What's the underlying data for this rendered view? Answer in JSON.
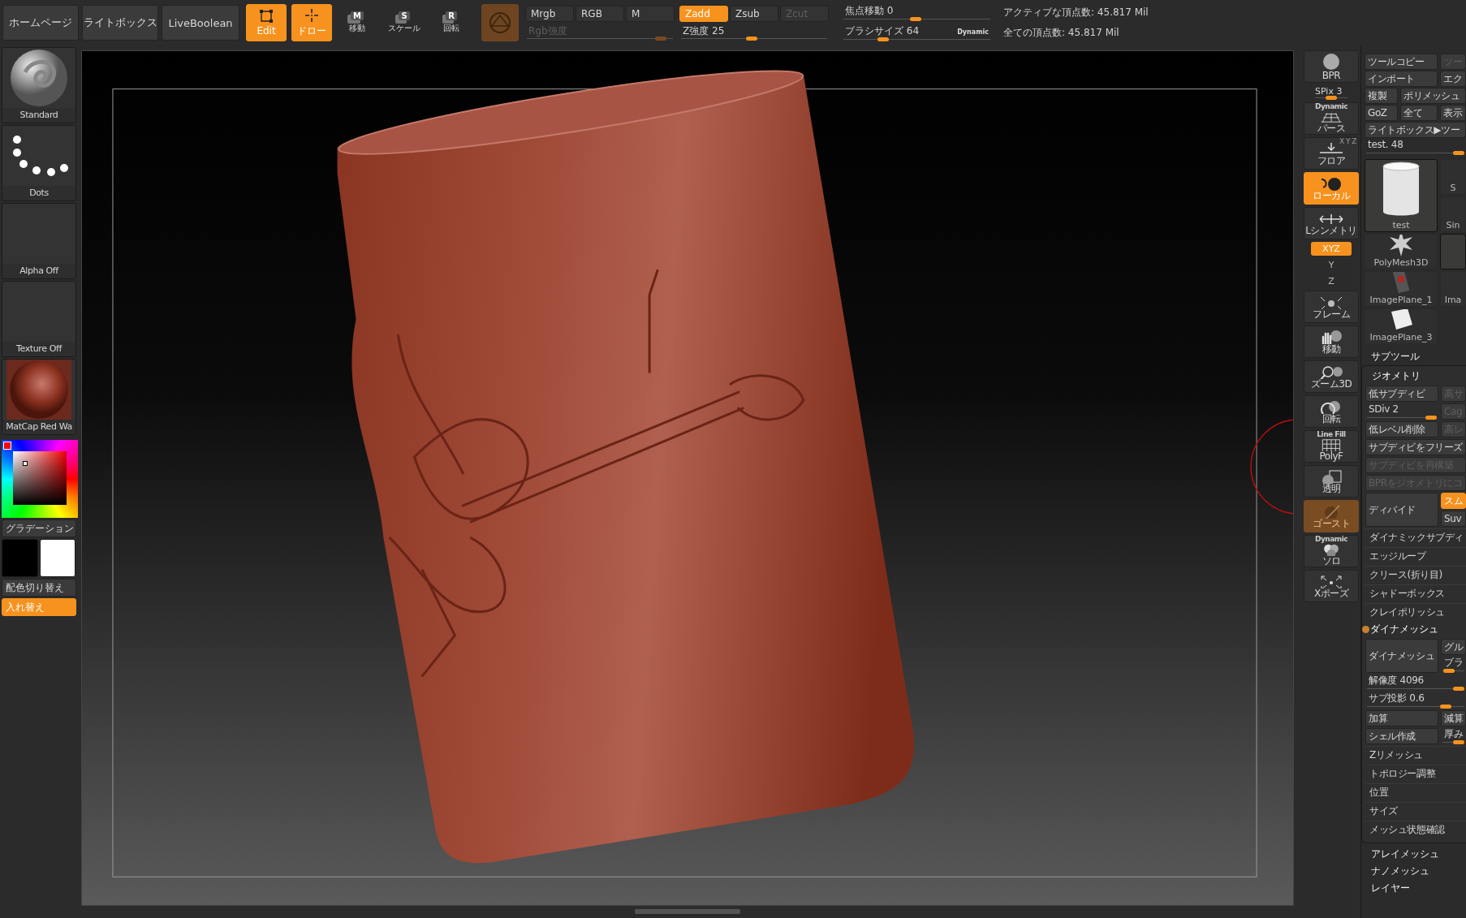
{
  "top_bar": {
    "nav_buttons": [
      "ホームページ",
      "ライトボックス",
      "LiveBoolean"
    ],
    "mode_buttons": [
      {
        "kind": "edit",
        "label": "Edit",
        "selected": true
      },
      {
        "kind": "draw",
        "label": "ドロー",
        "selected": true
      }
    ],
    "transform_buttons": [
      {
        "key": "M",
        "label": "移動"
      },
      {
        "key": "S",
        "label": "スケール"
      },
      {
        "key": "R",
        "label": "回転"
      }
    ],
    "channel_groups": [
      {
        "buttons": [
          {
            "label": "Mrgb",
            "selected": false,
            "disabled": false
          },
          {
            "label": "RGB",
            "selected": false,
            "disabled": false
          },
          {
            "label": "M",
            "selected": false,
            "disabled": false
          }
        ],
        "slider": {
          "label": "Rgb強度",
          "disabled": true,
          "level": 0.95
        }
      },
      {
        "buttons": [
          {
            "label": "Zadd",
            "selected": true,
            "disabled": false
          },
          {
            "label": "Zsub",
            "selected": false,
            "disabled": false
          },
          {
            "label": "Zcut",
            "selected": false,
            "disabled": true
          }
        ],
        "slider": {
          "label": "Z強度 25",
          "disabled": false,
          "level": 0.48
        }
      }
    ],
    "brush_sliders": [
      {
        "label": "焦点移動 0",
        "level": 0.49
      },
      {
        "label": "ブラシサイズ 64",
        "badge": "Dynamic",
        "level": 0.25
      }
    ],
    "stats": [
      "アクティブな頂点数: 45.817 Mil",
      "全ての頂点数: 45.817 Mil"
    ]
  },
  "left_shelf": {
    "tiles": [
      {
        "kind": "brush",
        "label": "Standard"
      },
      {
        "kind": "stroke",
        "label": "Dots"
      },
      {
        "kind": "alpha",
        "label": "Alpha Off"
      },
      {
        "kind": "texture",
        "label": "Texture Off"
      },
      {
        "kind": "material",
        "label": "MatCap Red Wa"
      }
    ],
    "gradient_button": "グラデーション",
    "swatches": [
      {
        "color": "#000000"
      },
      {
        "color": "#ffffff"
      }
    ],
    "buttons": [
      {
        "label": "配色切り替え",
        "selected": false
      },
      {
        "label": "入れ替え",
        "selected": true
      }
    ]
  },
  "view_toolbar": [
    {
      "kind": "bpr",
      "label": "BPR"
    },
    {
      "kind": "slider",
      "label": "SPix 3",
      "level": 0.5
    },
    {
      "kind": "perspective",
      "caption": "Dynamic",
      "label": "パース",
      "selected": false,
      "disabled": false
    },
    {
      "kind": "floor",
      "caption": "X Y Z",
      "label": "フロア",
      "selected": false,
      "disabled": false
    },
    {
      "kind": "local",
      "label": "ローカル",
      "selected": true,
      "disabled": false
    },
    {
      "kind": "symmetry",
      "label": "Lシンメトリ",
      "selected": false,
      "disabled": false
    },
    {
      "kind": "axis",
      "label": "XYZ",
      "selected": true,
      "disabled": false
    },
    {
      "kind": "axis",
      "label": "Y",
      "selected": false,
      "disabled": false
    },
    {
      "kind": "axis",
      "label": "Z",
      "selected": false,
      "disabled": false
    },
    {
      "kind": "frame",
      "label": "フレーム",
      "selected": false,
      "disabled": false
    },
    {
      "kind": "move",
      "label": "移動",
      "selected": false,
      "disabled": false
    },
    {
      "kind": "zoom",
      "label": "ズーム3D",
      "selected": false,
      "disabled": false
    },
    {
      "kind": "rotate",
      "label": "回転",
      "selected": false,
      "disabled": false
    },
    {
      "kind": "polyf",
      "caption": "Line Fill",
      "label": "PolyF",
      "selected": false,
      "disabled": false
    },
    {
      "kind": "transparent",
      "label": "透明",
      "selected": false,
      "disabled": false
    },
    {
      "kind": "ghost",
      "label": "ゴースト",
      "selected": false,
      "disabled": true
    },
    {
      "kind": "solo",
      "caption": "Dynamic",
      "label": "ソロ",
      "selected": false,
      "disabled": false
    },
    {
      "kind": "xpose",
      "label": "Xポーズ",
      "selected": false,
      "disabled": false
    }
  ],
  "tool_panel": {
    "rows": [
      {
        "kind": "pair",
        "items": [
          {
            "kind": "button",
            "label": "ツールコピー",
            "disabled": false
          },
          {
            "kind": "button",
            "label": "ツー",
            "disabled": true
          }
        ]
      },
      {
        "kind": "pair",
        "items": [
          {
            "kind": "button",
            "label": "インポート",
            "disabled": false
          },
          {
            "kind": "button",
            "label": "エク",
            "disabled": false
          }
        ]
      },
      {
        "kind": "lead",
        "items": [
          {
            "kind": "button",
            "label": "複製",
            "disabled": false
          },
          {
            "kind": "button",
            "label": "ポリメッシュ",
            "disabled": false
          }
        ]
      },
      {
        "kind": "trio",
        "items": [
          {
            "kind": "button",
            "label": "GoZ",
            "disabled": false
          },
          {
            "kind": "button",
            "label": "全て",
            "disabled": false
          },
          {
            "kind": "button",
            "label": "表示",
            "disabled": false
          }
        ]
      },
      {
        "kind": "full",
        "items": [
          {
            "kind": "button",
            "label": "ライトボックス▶ツー",
            "disabled": false
          }
        ]
      },
      {
        "kind": "full",
        "items": [
          {
            "kind": "slider",
            "label": "test. 48",
            "level": 1
          }
        ]
      }
    ],
    "thumbnails": [
      {
        "kind": "cylinder",
        "label": "test",
        "selected": true
      },
      {
        "kind": "star",
        "label": "PolyMesh3D",
        "selected": false
      },
      {
        "kind": "card",
        "label": "ImagePlane_1",
        "selected": false
      },
      {
        "kind": "cube",
        "label": "ImagePlane_3",
        "selected": false
      },
      {
        "kind": "blank",
        "label": "S",
        "selected": false
      },
      {
        "kind": "blank",
        "label": "Sin",
        "selected": false
      },
      {
        "kind": "blank",
        "selected": true
      },
      {
        "kind": "blank",
        "label": "Ima",
        "selected": false
      }
    ]
  },
  "subtool_header": "サブツール",
  "geometry": {
    "title": "ジオメトリ",
    "rows": [
      {
        "kind": "pair",
        "items": [
          {
            "kind": "button",
            "label": "低サブディビ",
            "disabled": false
          },
          {
            "kind": "button",
            "label": "高サ",
            "disabled": true
          }
        ]
      },
      {
        "kind": "pair",
        "items": [
          {
            "kind": "slider",
            "label": "SDiv 2",
            "level": 1
          },
          {
            "kind": "button",
            "label": "Cag",
            "disabled": true
          }
        ]
      },
      {
        "kind": "pair",
        "items": [
          {
            "kind": "button",
            "label": "低レベル削除",
            "disabled": false
          },
          {
            "kind": "button",
            "label": "高レ",
            "disabled": true
          }
        ]
      },
      {
        "kind": "full",
        "items": [
          {
            "kind": "button",
            "label": "サブディビをフリーズ",
            "disabled": false
          }
        ]
      },
      {
        "kind": "full",
        "items": [
          {
            "kind": "button",
            "label": "サブディビを再構築",
            "disabled": true
          }
        ]
      },
      {
        "kind": "full",
        "items": [
          {
            "kind": "button",
            "label": "BPRをジオメトリにコ",
            "disabled": true
          }
        ]
      },
      {
        "kind": "block",
        "items": [
          {
            "kind": "button",
            "label": "ディバイド",
            "disabled": false
          },
          {
            "kind": "button",
            "label": "スム",
            "disabled": false,
            "selected": true
          },
          {
            "kind": "button",
            "label": "Suv",
            "disabled": false
          }
        ]
      },
      {
        "kind": "menu",
        "label": "ダイナミックサブディ"
      },
      {
        "kind": "menu",
        "label": "エッジループ"
      },
      {
        "kind": "menu",
        "label": "クリース(折り目)"
      },
      {
        "kind": "menu",
        "label": "シャドーボックス"
      },
      {
        "kind": "menu",
        "label": "クレイポリッシュ"
      },
      {
        "kind": "toggle",
        "label": "ダイナメッシュ",
        "on": true
      },
      {
        "kind": "block",
        "items": [
          {
            "kind": "button",
            "label": "ダイナメッシュ",
            "disabled": false
          },
          {
            "kind": "button",
            "label": "グル",
            "disabled": false
          },
          {
            "kind": "slider",
            "label": "ブラ",
            "level": 0.1
          }
        ]
      },
      {
        "kind": "full",
        "items": [
          {
            "kind": "slider",
            "label": "解像度 4096",
            "level": 1
          }
        ]
      },
      {
        "kind": "full",
        "items": [
          {
            "kind": "slider",
            "label": "サブ投影 0.6",
            "level": 0.85
          }
        ]
      },
      {
        "kind": "pair",
        "items": [
          {
            "kind": "button",
            "label": "加算",
            "disabled": false
          },
          {
            "kind": "button",
            "label": "減算",
            "disabled": false
          }
        ]
      },
      {
        "kind": "pair",
        "items": [
          {
            "kind": "button",
            "label": "シェル作成",
            "disabled": false
          },
          {
            "kind": "slider",
            "label": "厚み",
            "level": 1
          }
        ]
      },
      {
        "kind": "menu",
        "label": "Zリメッシュ"
      },
      {
        "kind": "menu",
        "label": "トポロジー調整"
      },
      {
        "kind": "menu",
        "label": "位置"
      },
      {
        "kind": "menu",
        "label": "サイズ"
      },
      {
        "kind": "menu",
        "label": "メッシュ状態確認"
      }
    ]
  },
  "sections": [
    "アレイメッシュ",
    "ナノメッシュ",
    "レイヤー"
  ]
}
